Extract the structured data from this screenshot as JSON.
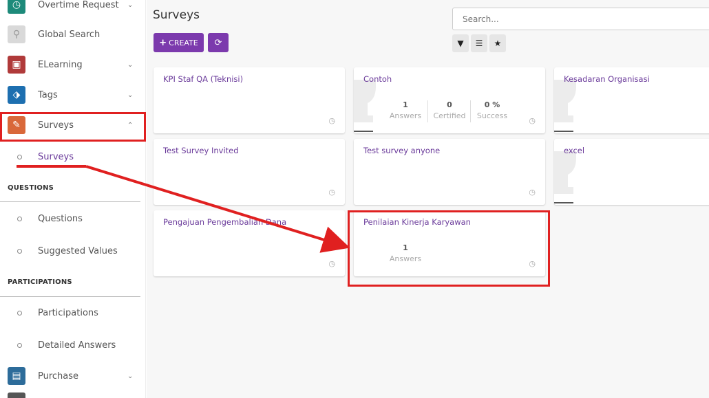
{
  "sidebar": {
    "apps": {
      "overtime": "Overtime Request",
      "global_search": "Global Search",
      "elearning": "ELearning",
      "tags": "Tags",
      "surveys": "Surveys",
      "purchase": "Purchase"
    },
    "surveys_sub": "Surveys",
    "questions_head": "QUESTIONS",
    "questions": "Questions",
    "suggested_values": "Suggested Values",
    "participations_head": "PARTICIPATIONS",
    "participations": "Participations",
    "detailed_answers": "Detailed Answers"
  },
  "main": {
    "title": "Surveys",
    "create_label": "CREATE",
    "search_placeholder": "Search..."
  },
  "cards": [
    {
      "title": "KPI Staf QA (Teknisi)"
    },
    {
      "title": "Contoh",
      "stats": [
        {
          "value": "1",
          "label": "Answers"
        },
        {
          "value": "0",
          "label": "Certified"
        },
        {
          "value": "0 %",
          "label": "Success"
        }
      ]
    },
    {
      "title": "Kesadaran Organisasi"
    },
    {
      "title": "Test Survey Invited"
    },
    {
      "title": "Test survey anyone"
    },
    {
      "title": "excel"
    },
    {
      "title": "Pengajuan Pengembalian Dana"
    },
    {
      "title": "Penilaian Kinerja Karyawan",
      "stats": [
        {
          "value": "1",
          "label": "Answers"
        }
      ]
    }
  ],
  "colors": {
    "accent": "#7c3aad",
    "annotation": "#e02020"
  }
}
